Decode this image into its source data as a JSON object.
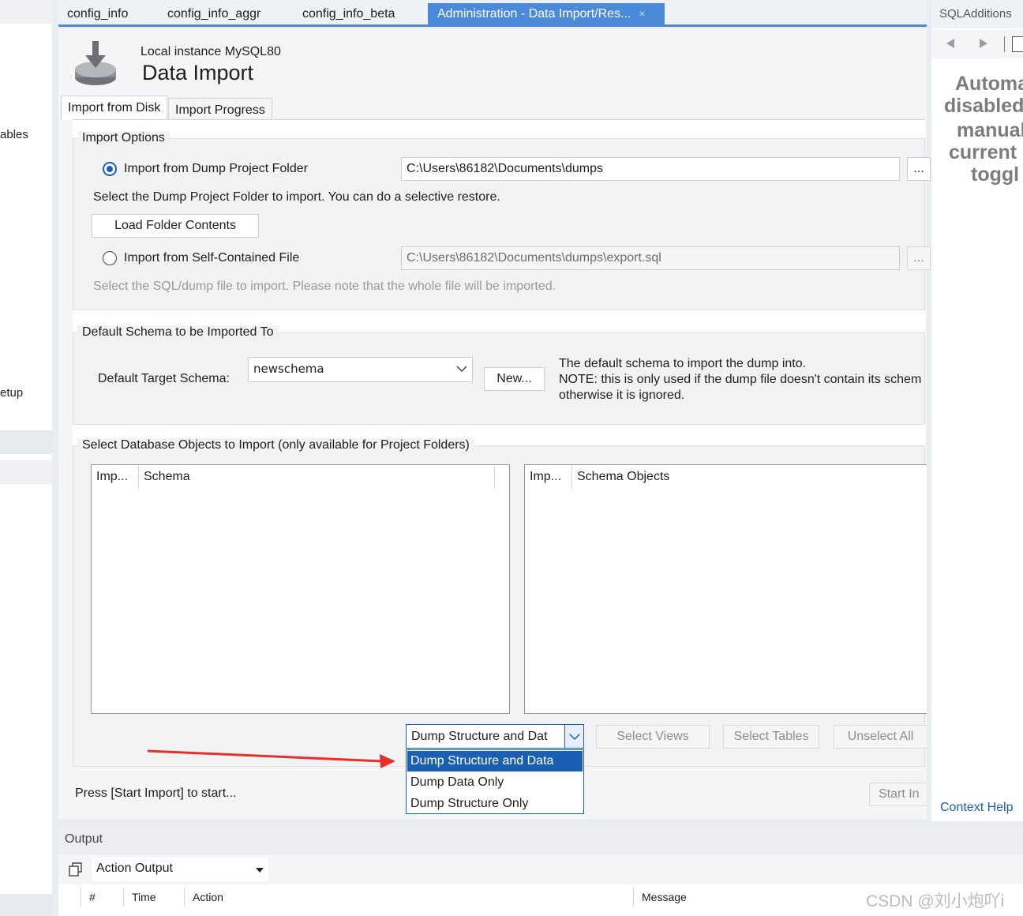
{
  "left_strip": {
    "item_tables": "ables",
    "item_setup": "etup"
  },
  "tabs": [
    {
      "label": "config_info"
    },
    {
      "label": "config_info_aggr"
    },
    {
      "label": "config_info_beta"
    },
    {
      "label": "Administration - Data Import/Res...",
      "close": "×"
    }
  ],
  "header": {
    "instance": "Local instance MySQL80",
    "title": "Data Import"
  },
  "subtabs": [
    "Import from Disk",
    "Import Progress"
  ],
  "import_options": {
    "title": "Import Options",
    "radio_folder_label": "Import from Dump Project Folder",
    "folder_path": "C:\\Users\\86182\\Documents\\dumps",
    "browse_label": "...",
    "folder_hint": "Select the Dump Project Folder to import. You can do a selective restore.",
    "load_button": "Load Folder Contents",
    "radio_file_label": "Import from Self-Contained File",
    "file_path": "C:\\Users\\86182\\Documents\\dumps\\export.sql",
    "file_hint": "Select the SQL/dump file to import. Please note that the whole file will be imported."
  },
  "default_schema": {
    "title": "Default Schema to be Imported To",
    "label": "Default Target Schema:",
    "value": "newschema",
    "new_button": "New...",
    "note_line1": "The default schema to import the dump into.",
    "note_line2": "NOTE: this is only used if the dump file doesn't contain its schem",
    "note_line3": "otherwise it is ignored."
  },
  "objects": {
    "title": "Select Database Objects to Import (only available for Project Folders)",
    "left_cols": [
      "Imp...",
      "Schema"
    ],
    "right_cols": [
      "Imp...",
      "Schema Objects"
    ],
    "dump_select": "Dump Structure and Dat",
    "dump_options": [
      "Dump Structure and Data",
      "Dump Data Only",
      "Dump Structure Only"
    ],
    "select_views": "Select Views",
    "select_tables": "Select Tables",
    "unselect_all": "Unselect All"
  },
  "status": {
    "text": "Press [Start Import] to start...",
    "start_button": "Start In"
  },
  "right_panel": {
    "title": "SQLAdditions",
    "lines": [
      "Automa",
      "disabled",
      "manual",
      "current",
      "toggl"
    ],
    "context_help": "Context Help"
  },
  "output": {
    "title": "Output",
    "dropdown": "Action Output",
    "columns": [
      "#",
      "Time",
      "Action",
      "Message"
    ]
  },
  "watermark": "CSDN @刘小炮吖i",
  "colors": {
    "accent": "#4a8ad8",
    "selection": "#1a5fb4",
    "annotation_arrow": "#e8302a"
  }
}
